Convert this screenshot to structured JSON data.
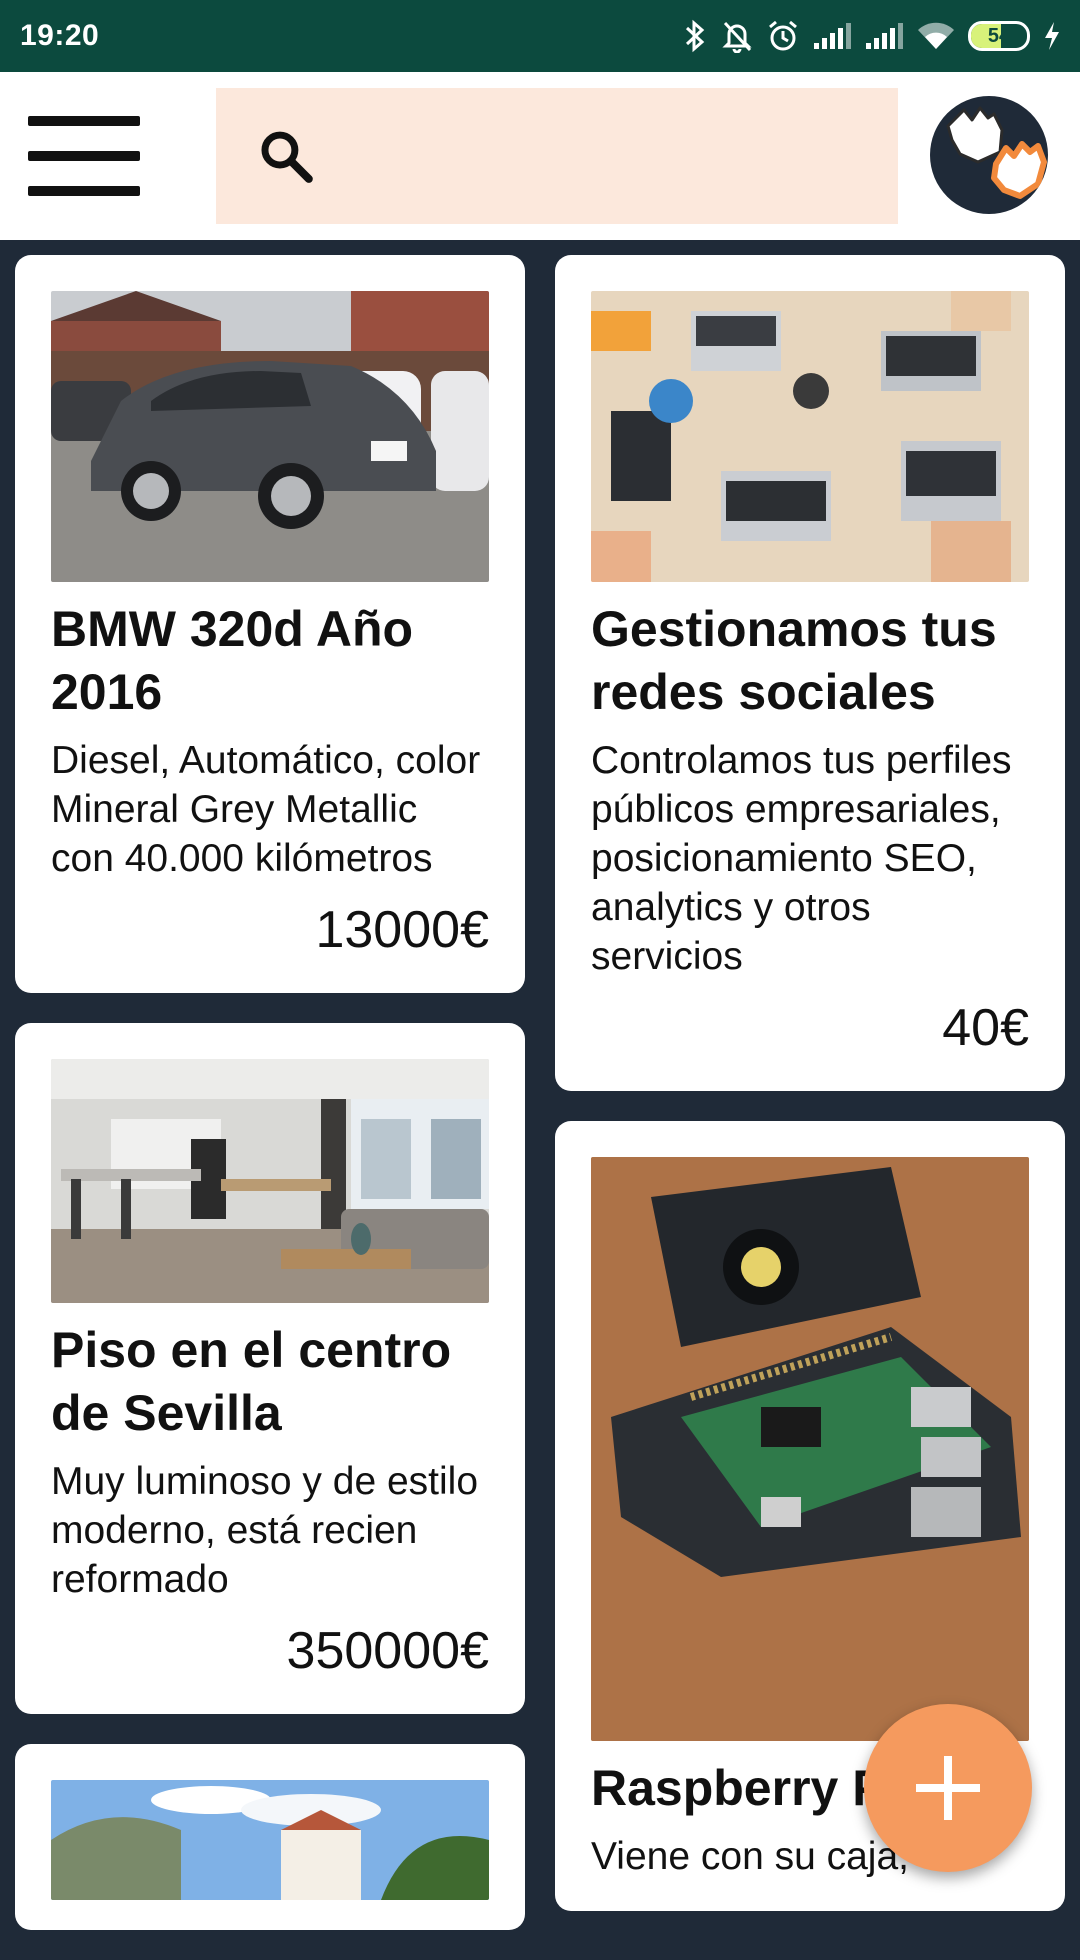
{
  "status_bar": {
    "time": "19:20",
    "battery_level": "54",
    "battery_fraction": 0.54
  },
  "app_bar": {
    "menu_icon": "hamburger-menu-icon",
    "search_icon": "search-icon",
    "search_placeholder": "",
    "logo_icon": "hands-logo-icon"
  },
  "colors": {
    "status_bar": "#0c4a3e",
    "background": "#1f2a38",
    "search_bg": "#fce8dc",
    "accent": "#f59a5e"
  },
  "listings": [
    {
      "title": "BMW 320d Año 2016",
      "description": "Diesel, Automático, color Mineral Grey Metallic con 40.000 kilómetros",
      "price": "13000€",
      "image": "grey-bmw-car-photo"
    },
    {
      "title": "Gestionamos tus redes sociales",
      "description": "Controlamos tus perfiles públicos empresariales, posicionamiento SEO, analytics y otros servicios",
      "price": "40€",
      "image": "desk-with-laptops-photo"
    },
    {
      "title": "Piso en el centro de Sevilla",
      "description": "Muy luminoso y de estilo moderno, está recien reformado",
      "price": "350000€",
      "image": "modern-apartment-photo"
    },
    {
      "title": "Raspberry Pi",
      "description": "Viene con su caja,",
      "price": "",
      "image": "raspberry-pi-board-photo"
    },
    {
      "title": "",
      "description": "",
      "price": "",
      "image": "village-landscape-photo"
    }
  ],
  "fab": {
    "icon": "plus-icon"
  }
}
